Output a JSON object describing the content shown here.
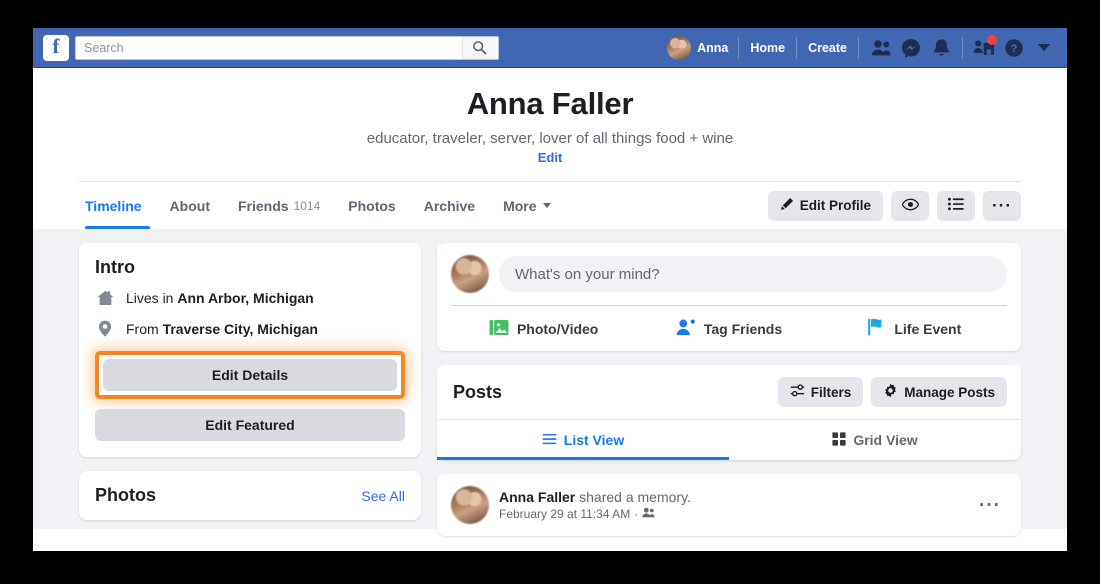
{
  "topbar": {
    "logo": "f",
    "search": {
      "value": "",
      "placeholder": "Search",
      "icon": "search-icon"
    },
    "user": {
      "name": "Anna",
      "avatar": "user-avatar"
    },
    "links": [
      {
        "label": "Home",
        "name": "home-link"
      },
      {
        "label": "Create",
        "name": "create-link"
      }
    ],
    "icons": [
      {
        "name": "friend-requests-icon"
      },
      {
        "name": "messenger-icon"
      },
      {
        "name": "notifications-icon"
      },
      {
        "name": "account-pages-icon",
        "badge": true
      },
      {
        "name": "help-icon"
      },
      {
        "name": "account-menu-caret-icon"
      }
    ],
    "accent": "#4267b2"
  },
  "profile": {
    "name": "Anna Faller",
    "bio": "educator, traveler, server, lover of all things food + wine",
    "edit_link": "Edit"
  },
  "tabs": [
    {
      "label": "Timeline",
      "count": "",
      "active": true
    },
    {
      "label": "About",
      "count": "",
      "active": false
    },
    {
      "label": "Friends",
      "count": "1014",
      "active": false
    },
    {
      "label": "Photos",
      "count": "",
      "active": false
    },
    {
      "label": "Archive",
      "count": "",
      "active": false
    },
    {
      "label": "More",
      "count": "",
      "active": false,
      "caret": true
    }
  ],
  "tab_actions": {
    "edit_profile": "Edit Profile",
    "view_as": "",
    "activity_log": "",
    "more": "···"
  },
  "intro": {
    "title": "Intro",
    "rows": [
      {
        "prefix": "Lives in",
        "value": "Ann Arbor, Michigan",
        "icon": "home-icon"
      },
      {
        "prefix": "From",
        "value": "Traverse City, Michigan",
        "icon": "location-pin-icon"
      }
    ],
    "edit_details": "Edit Details",
    "edit_featured": "Edit Featured",
    "highlight_color": "#f5871f"
  },
  "photos": {
    "title": "Photos",
    "see_all": "See All"
  },
  "composer": {
    "placeholder": "What's on your mind?",
    "value": "",
    "actions": [
      {
        "label": "Photo/Video",
        "icon": "photo-video-icon",
        "color": "#45bd62"
      },
      {
        "label": "Tag Friends",
        "icon": "tag-friends-icon",
        "color": "#1877f2"
      },
      {
        "label": "Life Event",
        "icon": "life-event-icon",
        "color": "#1aa9e1"
      }
    ]
  },
  "posts": {
    "title": "Posts",
    "filters": "Filters",
    "manage": "Manage Posts",
    "views": [
      {
        "label": "List View",
        "icon": "list-view-icon",
        "active": true
      },
      {
        "label": "Grid View",
        "icon": "grid-view-icon",
        "active": false
      }
    ]
  },
  "post": {
    "author": "Anna Faller",
    "action": " shared a memory.",
    "timestamp": "February 29 at 11:34 AM",
    "separator": "·",
    "audience_icon": "friends-audience-icon",
    "more": "···"
  }
}
